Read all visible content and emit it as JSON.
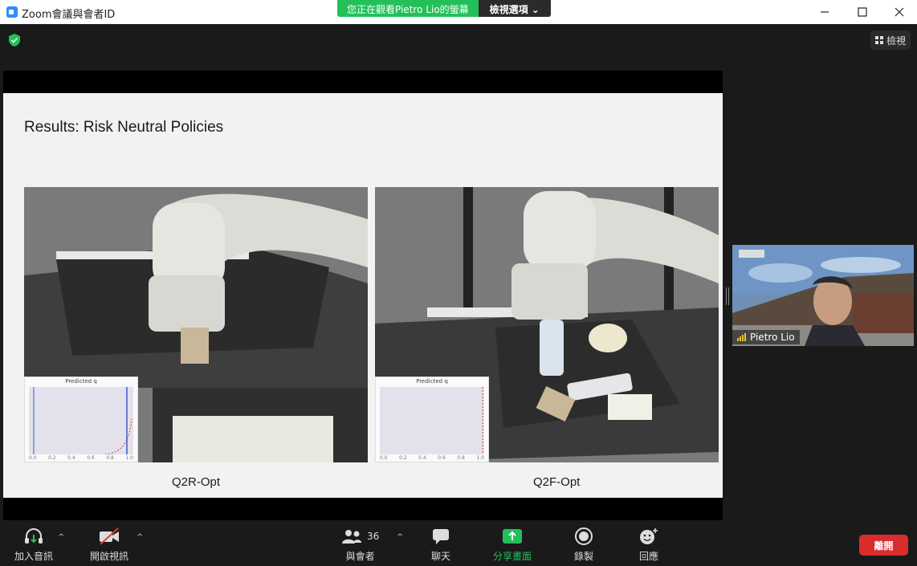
{
  "window": {
    "title": "Zoom會議與會者ID",
    "viewing_banner": "您正在觀看Pietro  Lio的螢幕",
    "view_options": "檢視選項 ⌄",
    "minimize_icon": "minimize-icon",
    "maximize_icon": "maximize-icon",
    "close_icon": "close-icon"
  },
  "top_right": {
    "view_label": "檢視"
  },
  "slide": {
    "title": "Results: Risk Neutral Policies",
    "panels": [
      {
        "caption": "Q2R-Opt",
        "inset_title": "Predicted q",
        "ticks": [
          "0.0",
          "0.2",
          "0.4",
          "0.6",
          "0.8",
          "1.0"
        ]
      },
      {
        "caption": "Q2F-Opt",
        "inset_title": "Predicted q",
        "ticks": [
          "0.0",
          "0.2",
          "0.4",
          "0.6",
          "0.8",
          "1.0"
        ]
      }
    ]
  },
  "participant": {
    "name": "Pietro Lio"
  },
  "toolbar": {
    "audio": "加入音訊",
    "video": "開啟視訊",
    "participants": "與會者",
    "participants_count": "36",
    "chat": "聊天",
    "share": "分享畫面",
    "record": "錄製",
    "reactions": "回應",
    "leave": "離開"
  },
  "colors": {
    "share_green": "#23c05a",
    "leave_red": "#d92d2d",
    "accent_blue": "#2d8cff"
  }
}
